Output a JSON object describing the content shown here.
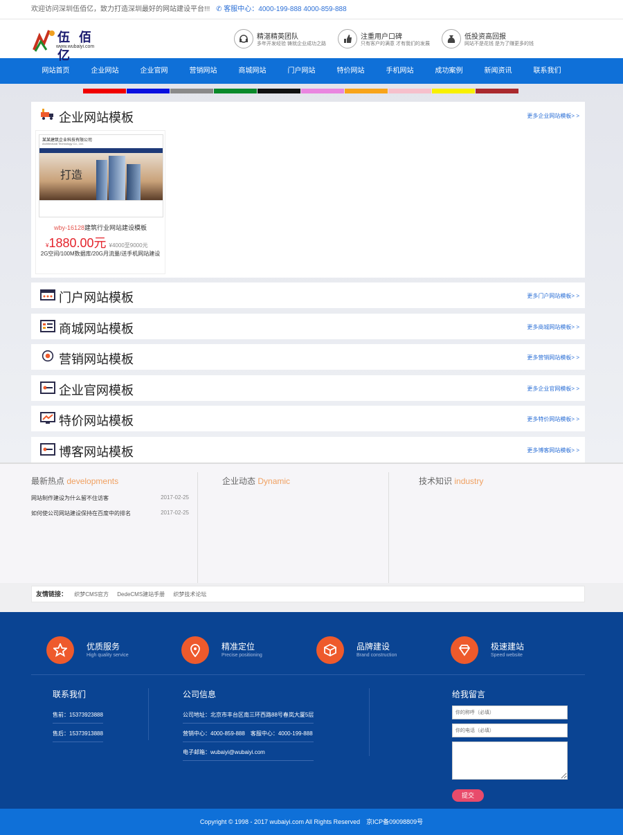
{
  "topbar": {
    "welcome": "欢迎访问深圳伍佰亿，致力打造深圳最好的网站建设平台!!!",
    "phone_icon": "phone-icon",
    "service": "客服中心：4000-199-888 4000-859-888"
  },
  "logo": {
    "name": "伍 佰 亿",
    "url": "www.wubaiyi.com"
  },
  "features": [
    {
      "icon": "headset-icon",
      "title": "精湛精英团队",
      "sub": "多年开发经验 铸就企业成功之路"
    },
    {
      "icon": "thumbs-up-icon",
      "title": "注重用户口碑",
      "sub": "只有客户的满意 才有我们的发展"
    },
    {
      "icon": "money-bag-icon",
      "title": "低投资高回报",
      "sub": "网站不是花钱 是为了赚更多的钱"
    }
  ],
  "nav": [
    "网站首页",
    "企业网站",
    "企业官网",
    "营销网站",
    "商城网站",
    "门户网站",
    "特价网站",
    "手机网站",
    "成功案例",
    "新闻资讯",
    "联系我们"
  ],
  "colorbar": [
    "#f00000",
    "#0a10e0",
    "#8a8a8a",
    "#0a8a2a",
    "#111111",
    "#ea86e0",
    "#f8a41a",
    "#f6c0cc",
    "#f8f000",
    "#aa2a2e"
  ],
  "sections": [
    {
      "title": "企业网站模板",
      "more": "更多企业网站模板> >",
      "icon": "truck-icon"
    },
    {
      "title": "门户网站模板",
      "more": "更多门户网站模板> >",
      "icon": "window-icon"
    },
    {
      "title": "商城网站模板",
      "more": "更多商城网站模板> >",
      "icon": "cart-icon"
    },
    {
      "title": "营销网站模板",
      "more": "更多营销网站模板> >",
      "icon": "target-icon"
    },
    {
      "title": "企业官网模板",
      "more": "更多企业官网模板> >",
      "icon": "key-icon"
    },
    {
      "title": "特价网站模板",
      "more": "更多特价网站模板> >",
      "icon": "monitor-icon"
    },
    {
      "title": "博客网站模板",
      "more": "更多博客网站模板> >",
      "icon": "key-icon"
    }
  ],
  "card": {
    "code": "wby-16128",
    "name": "建筑行业网站建设模板",
    "currency": "¥",
    "price": "1880.00元",
    "old": "¥4000至9000元",
    "desc": "2G空间/100M数据库/20G月流量/送手机网站建设",
    "shot_company": "某某建筑企业科技有限公司",
    "shot_company_en": "Architectural Technology Co., Ltd.",
    "shot_banner": "打造"
  },
  "news": [
    {
      "cn": "最新热点",
      "en": "developments",
      "items": [
        {
          "t": "网站制作建设为什么留不住访客",
          "d": "2017-02-25"
        },
        {
          "t": "如何使公司网站建设保持在百度中的排名",
          "d": "2017-02-25"
        }
      ]
    },
    {
      "cn": "企业动态",
      "en": "Dynamic",
      "items": []
    },
    {
      "cn": "技术知识",
      "en": "industry",
      "items": []
    }
  ],
  "links": {
    "label": "友情链接：",
    "items": [
      "织梦CMS官方",
      "DedeCMS建站手册",
      "织梦技术论坛"
    ]
  },
  "services": [
    {
      "icon": "star-icon",
      "title": "优质服务",
      "sub": "High quality service"
    },
    {
      "icon": "location-pin-icon",
      "title": "精准定位",
      "sub": "Precise positioning"
    },
    {
      "icon": "box-icon",
      "title": "品牌建设",
      "sub": "Brand construction"
    },
    {
      "icon": "diamond-icon",
      "title": "极速建站",
      "sub": "Speed website"
    }
  ],
  "contact": {
    "title": "联系我们",
    "pre": "售前：15373923888",
    "post": "售后：15373913888"
  },
  "company": {
    "title": "公司信息",
    "addr": "公司地址：北京市丰台区南三环西路88号春岚大厦5层",
    "phones": "营销中心：4000-859-888　客服中心：4000-199-888",
    "email": "电子邮箱：wubaiyi@wubaiyi.com"
  },
  "message": {
    "title": "给我留言",
    "name_ph": "你的称呼（必填）",
    "phone_ph": "你的电话（必填）",
    "submit": "提交"
  },
  "copyright": "Copyright © 1998 - 2017 wubaiyi.com All Rights Reserved　京ICP备09098809号"
}
